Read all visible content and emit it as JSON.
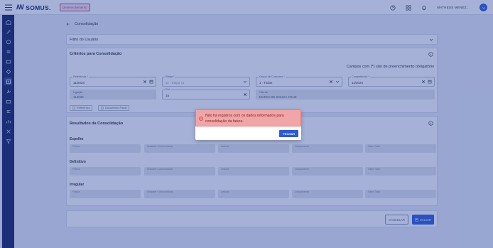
{
  "topbar": {
    "logo_text": "SOMUS.",
    "env_badge": "Desenvolvimento",
    "user_name": "MATHEUS MENEZ..."
  },
  "page": {
    "back_label": "Consolidação"
  },
  "filter_card": {
    "title": "Filtro do Usuário"
  },
  "criteria": {
    "title": "Critérios para Consolidação",
    "required_note": "Campos com (*) são de preenchimento obrigatório",
    "fields": {
      "referencia": {
        "label": "Referência *",
        "value": "11/2024"
      },
      "etapa": {
        "label": "Etapa *",
        "value": "11 - Etapa 11"
      },
      "grupo": {
        "label": "Grupo de Consumo *",
        "value": "1 - Todos"
      },
      "competencia": {
        "label": "Competência *",
        "value": "11/2024"
      },
      "ligacao": {
        "label": "Ligação",
        "value": "113030"
      },
      "rol": {
        "label": "Rol",
        "value": "15"
      },
      "cliente": {
        "label": "Cliente",
        "value": "MARIO DE SOUZA CRUZ"
      }
    },
    "buttons": {
      "btn1": "Referência",
      "btn2": "Documento Fiscal"
    }
  },
  "results": {
    "title": "Resultados da Consolidação",
    "columns": [
      "Fatura",
      "Unidade Consumidora",
      "Leitura",
      "Lançamento",
      "Valor Total"
    ],
    "sections": [
      {
        "label": "Espelho",
        "values": [
          "-",
          "-",
          "-",
          "-",
          "-"
        ]
      },
      {
        "label": "Definitivo",
        "values": [
          "-",
          "-",
          "-",
          "-",
          "-"
        ]
      },
      {
        "label": "Irregular",
        "values": [
          "-",
          "-",
          "-",
          "-",
          "-"
        ]
      }
    ]
  },
  "footer": {
    "cancel_label": "CANCELAR",
    "save_label": "SALVAR"
  },
  "modal": {
    "message": "Não há registros com os dados informados para consolidação da fatura.",
    "button_label": "FECHAR"
  },
  "colors": {
    "sidebar": "#0e1f5b",
    "primary": "#2d5bd7",
    "alert_bg": "#f0a6a6",
    "overlay": "rgba(40,70,160,0.42)"
  }
}
